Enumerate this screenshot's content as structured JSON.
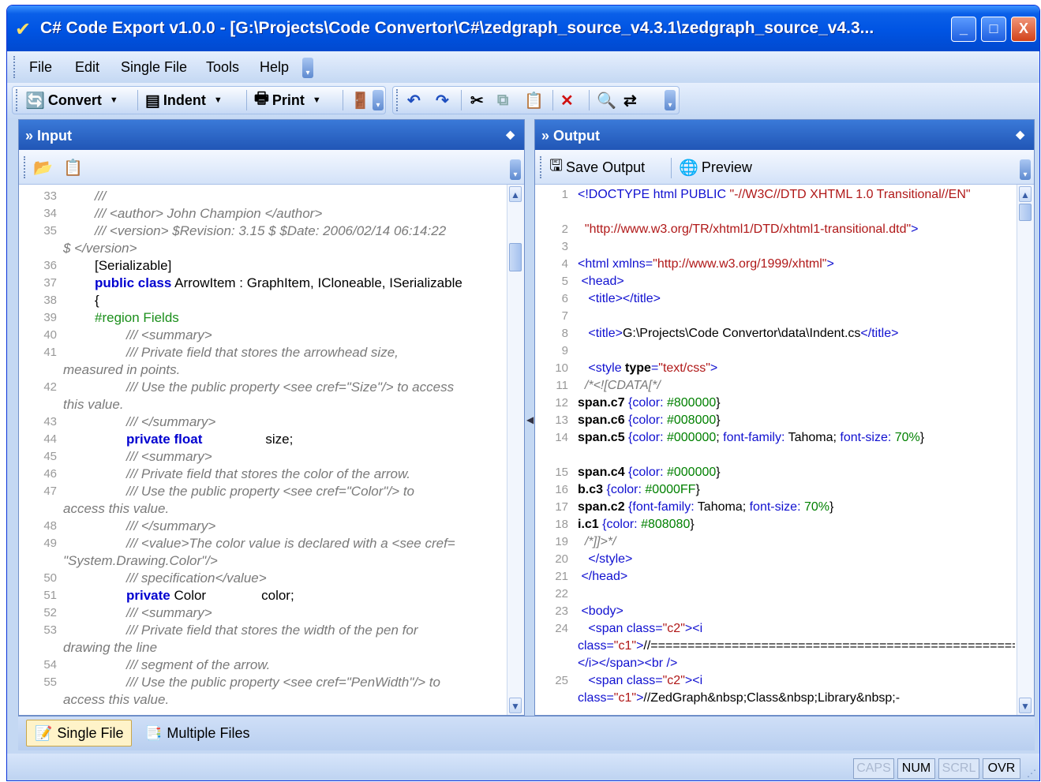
{
  "window": {
    "title": "C# Code Export v1.0.0 - [G:\\Projects\\Code Convertor\\C#\\zedgraph_source_v4.3.1\\zedgraph_source_v4.3...",
    "minimize": "_",
    "maximize": "□",
    "close": "X"
  },
  "menu": {
    "items": [
      "File",
      "Edit",
      "Single File",
      "Tools",
      "Help"
    ]
  },
  "toolbar": {
    "convert": "Convert",
    "indent": "Indent",
    "print": "Print"
  },
  "input": {
    "title": "» Input",
    "lines": [
      {
        "n": "33",
        "t": "///",
        "c": "cmt",
        "i": 1
      },
      {
        "n": "34",
        "t": "/// <author> John Champion </author>",
        "c": "cmt",
        "i": 1
      },
      {
        "n": "35",
        "t": "/// <version> $Revision: 3.15 $ $Date: 2006/02/14 06:14:22",
        "c": "cmt",
        "i": 1
      },
      {
        "n": "",
        "t": "$ </version>",
        "c": "cmt",
        "i": 0
      },
      {
        "n": "36",
        "t": "[Serializable]",
        "c": "nm",
        "i": 1
      },
      {
        "n": "37",
        "t": "public class",
        "t2": " ArrowItem : GraphItem, ICloneable, ISerializable",
        "c": "kw",
        "i": 1
      },
      {
        "n": "38",
        "t": "{",
        "c": "nm",
        "i": 1
      },
      {
        "n": "39",
        "t": "#region Fields",
        "c": "rg",
        "i": 1
      },
      {
        "n": "40",
        "t": "/// <summary>",
        "c": "cmt",
        "i": 2
      },
      {
        "n": "41",
        "t": "/// Private field that stores the arrowhead size,",
        "c": "cmt",
        "i": 2
      },
      {
        "n": "",
        "t": "measured in points.",
        "c": "cmt",
        "i": 0
      },
      {
        "n": "42",
        "t": "/// Use the public property <see cref=\"Size\"/> to access",
        "c": "cmt",
        "i": 2
      },
      {
        "n": "",
        "t": "this value.",
        "c": "cmt",
        "i": 0
      },
      {
        "n": "43",
        "t": "/// </summary>",
        "c": "cmt",
        "i": 2
      },
      {
        "n": "44",
        "t": "private float",
        "t2": "size;",
        "c": "kw",
        "i": 2,
        "gap": 1
      },
      {
        "n": "45",
        "t": "/// <summary>",
        "c": "cmt",
        "i": 2
      },
      {
        "n": "46",
        "t": "/// Private field that stores the color of the arrow.",
        "c": "cmt",
        "i": 2
      },
      {
        "n": "47",
        "t": "/// Use the public property <see cref=\"Color\"/> to",
        "c": "cmt",
        "i": 2
      },
      {
        "n": "",
        "t": "access this value.",
        "c": "cmt",
        "i": 0
      },
      {
        "n": "48",
        "t": "/// </summary>",
        "c": "cmt",
        "i": 2
      },
      {
        "n": "49",
        "t": "/// <value>The color value is declared with a <see cref=",
        "c": "cmt",
        "i": 2
      },
      {
        "n": "",
        "t": "\"System.Drawing.Color\"/>",
        "c": "cmt",
        "i": 0
      },
      {
        "n": "50",
        "t": "/// specification</value>",
        "c": "cmt",
        "i": 2
      },
      {
        "n": "51",
        "t": "private",
        "t2": " Color",
        "t3": "color;",
        "c": "kw",
        "i": 2,
        "gap": 1
      },
      {
        "n": "52",
        "t": "/// <summary>",
        "c": "cmt",
        "i": 2
      },
      {
        "n": "53",
        "t": "/// Private field that stores the width of the pen for",
        "c": "cmt",
        "i": 2
      },
      {
        "n": "",
        "t": "drawing the line",
        "c": "cmt",
        "i": 0
      },
      {
        "n": "54",
        "t": "/// segment of the arrow.",
        "c": "cmt",
        "i": 2
      },
      {
        "n": "55",
        "t": "/// Use the public property <see cref=\"PenWidth\"/> to",
        "c": "cmt",
        "i": 2
      },
      {
        "n": "",
        "t": "access this value.",
        "c": "cmt",
        "i": 0
      }
    ]
  },
  "output": {
    "title": "» Output",
    "save": "Save Output",
    "preview": "Preview",
    "lines": [
      {
        "n": "1",
        "h": "<span class='tg'>&lt;!DOCTYPE html PUBLIC </span><span class='av'>\"-//W3C//DTD XHTML 1.0 Transitional//EN\"</span>",
        "rows": 2
      },
      {
        "n": "2",
        "h": "&nbsp;&nbsp;<span class='av'>\"http://www.w3.org/TR/xhtml1/DTD/xhtml1-transitional.dtd\"</span><span class='tg'>&gt;</span>",
        "rows": 1
      },
      {
        "n": "3",
        "h": "",
        "rows": 1
      },
      {
        "n": "4",
        "h": "<span class='tg'>&lt;html xmlns=</span><span class='av'>\"http://www.w3.org/1999/xhtml\"</span><span class='tg'>&gt;</span>",
        "rows": 1
      },
      {
        "n": "5",
        "h": "&nbsp;<span class='tg'>&lt;head&gt;</span>",
        "rows": 1
      },
      {
        "n": "6",
        "h": "&nbsp;&nbsp;&nbsp;<span class='tg'>&lt;title&gt;&lt;/title&gt;</span>",
        "rows": 1
      },
      {
        "n": "7",
        "h": "",
        "rows": 1
      },
      {
        "n": "8",
        "h": "&nbsp;&nbsp;&nbsp;<span class='tg'>&lt;title&gt;</span>G:\\Projects\\Code Convertor\\data\\Indent.cs<span class='tg'>&lt;/title&gt;</span>",
        "rows": 1
      },
      {
        "n": "9",
        "h": "",
        "rows": 1
      },
      {
        "n": "10",
        "h": "&nbsp;&nbsp;&nbsp;<span class='tg'>&lt;style </span><span class='at'>type</span><span class='tg'>=</span><span class='av'>\"text/css\"</span><span class='tg'>&gt;</span>",
        "rows": 1
      },
      {
        "n": "11",
        "h": "&nbsp;&nbsp;<span class='cmt'>/*&lt;![CDATA[*/</span>",
        "rows": 1
      },
      {
        "n": "12",
        "h": "<span class='sel'>span.c7</span> <span class='tg'>{color:</span> <span class='pv'>#800000</span>}",
        "rows": 1
      },
      {
        "n": "13",
        "h": "<span class='sel'>span.c6</span> <span class='tg'>{color:</span> <span class='pv'>#008000</span>}",
        "rows": 1
      },
      {
        "n": "14",
        "h": "<span class='sel'>span.c5</span> <span class='tg'>{color:</span> <span class='pv'>#000000</span>; <span class='tg'>font-family:</span> Tahoma; <span class='tg'>font-size:</span> <span class='pv'>70%</span>}",
        "rows": 2
      },
      {
        "n": "15",
        "h": "<span class='sel'>span.c4</span> <span class='tg'>{color:</span> <span class='pv'>#000000</span>}",
        "rows": 1
      },
      {
        "n": "16",
        "h": "<span class='sel'>b.c3</span> <span class='tg'>{color:</span> <span class='pv'>#0000FF</span>}",
        "rows": 1
      },
      {
        "n": "17",
        "h": "<span class='sel'>span.c2</span> <span class='tg'>{font-family:</span> Tahoma; <span class='tg'>font-size:</span> <span class='pv'>70%</span>}",
        "rows": 1
      },
      {
        "n": "18",
        "h": "<span class='sel'>i.c1</span> <span class='tg'>{color:</span> <span class='pv'>#808080</span>}",
        "rows": 1
      },
      {
        "n": "19",
        "h": "&nbsp;&nbsp;<span class='cmt'>/*]]&gt;*/</span>",
        "rows": 1
      },
      {
        "n": "20",
        "h": "&nbsp;&nbsp;&nbsp;<span class='tg'>&lt;/style&gt;</span>",
        "rows": 1
      },
      {
        "n": "21",
        "h": "&nbsp;<span class='tg'>&lt;/head&gt;</span>",
        "rows": 1
      },
      {
        "n": "22",
        "h": "",
        "rows": 1
      },
      {
        "n": "23",
        "h": "&nbsp;<span class='tg'>&lt;body&gt;</span>",
        "rows": 1
      },
      {
        "n": "24",
        "h": "&nbsp;&nbsp;&nbsp;<span class='tg'>&lt;span class=</span><span class='av'>\"c2\"</span><span class='tg'>&gt;&lt;i class=</span><span class='av'>\"c1\"</span><span class='tg'>&gt;</span>//==================================================<span class='tg'>&lt;/i&gt;&lt;/span&gt;&lt;br /&gt;</span>",
        "rows": 3
      },
      {
        "n": "25",
        "h": "&nbsp;&nbsp;&nbsp;<span class='tg'>&lt;span class=</span><span class='av'>\"c2\"</span><span class='tg'>&gt;&lt;i class=</span><span class='av'>\"c1\"</span><span class='tg'>&gt;</span>//ZedGraph&amp;nbsp;Class&amp;nbsp;Library&amp;nbsp;-&amp;nbsp;A&amp;nbsp;Flexible&amp;nbsp;Line&amp;nbsp;",
        "rows": 2
      }
    ]
  },
  "tabs": {
    "single": "Single File",
    "multiple": "Multiple Files"
  },
  "status": {
    "caps": "CAPS",
    "num": "NUM",
    "scrl": "SCRL",
    "ovr": "OVR"
  }
}
